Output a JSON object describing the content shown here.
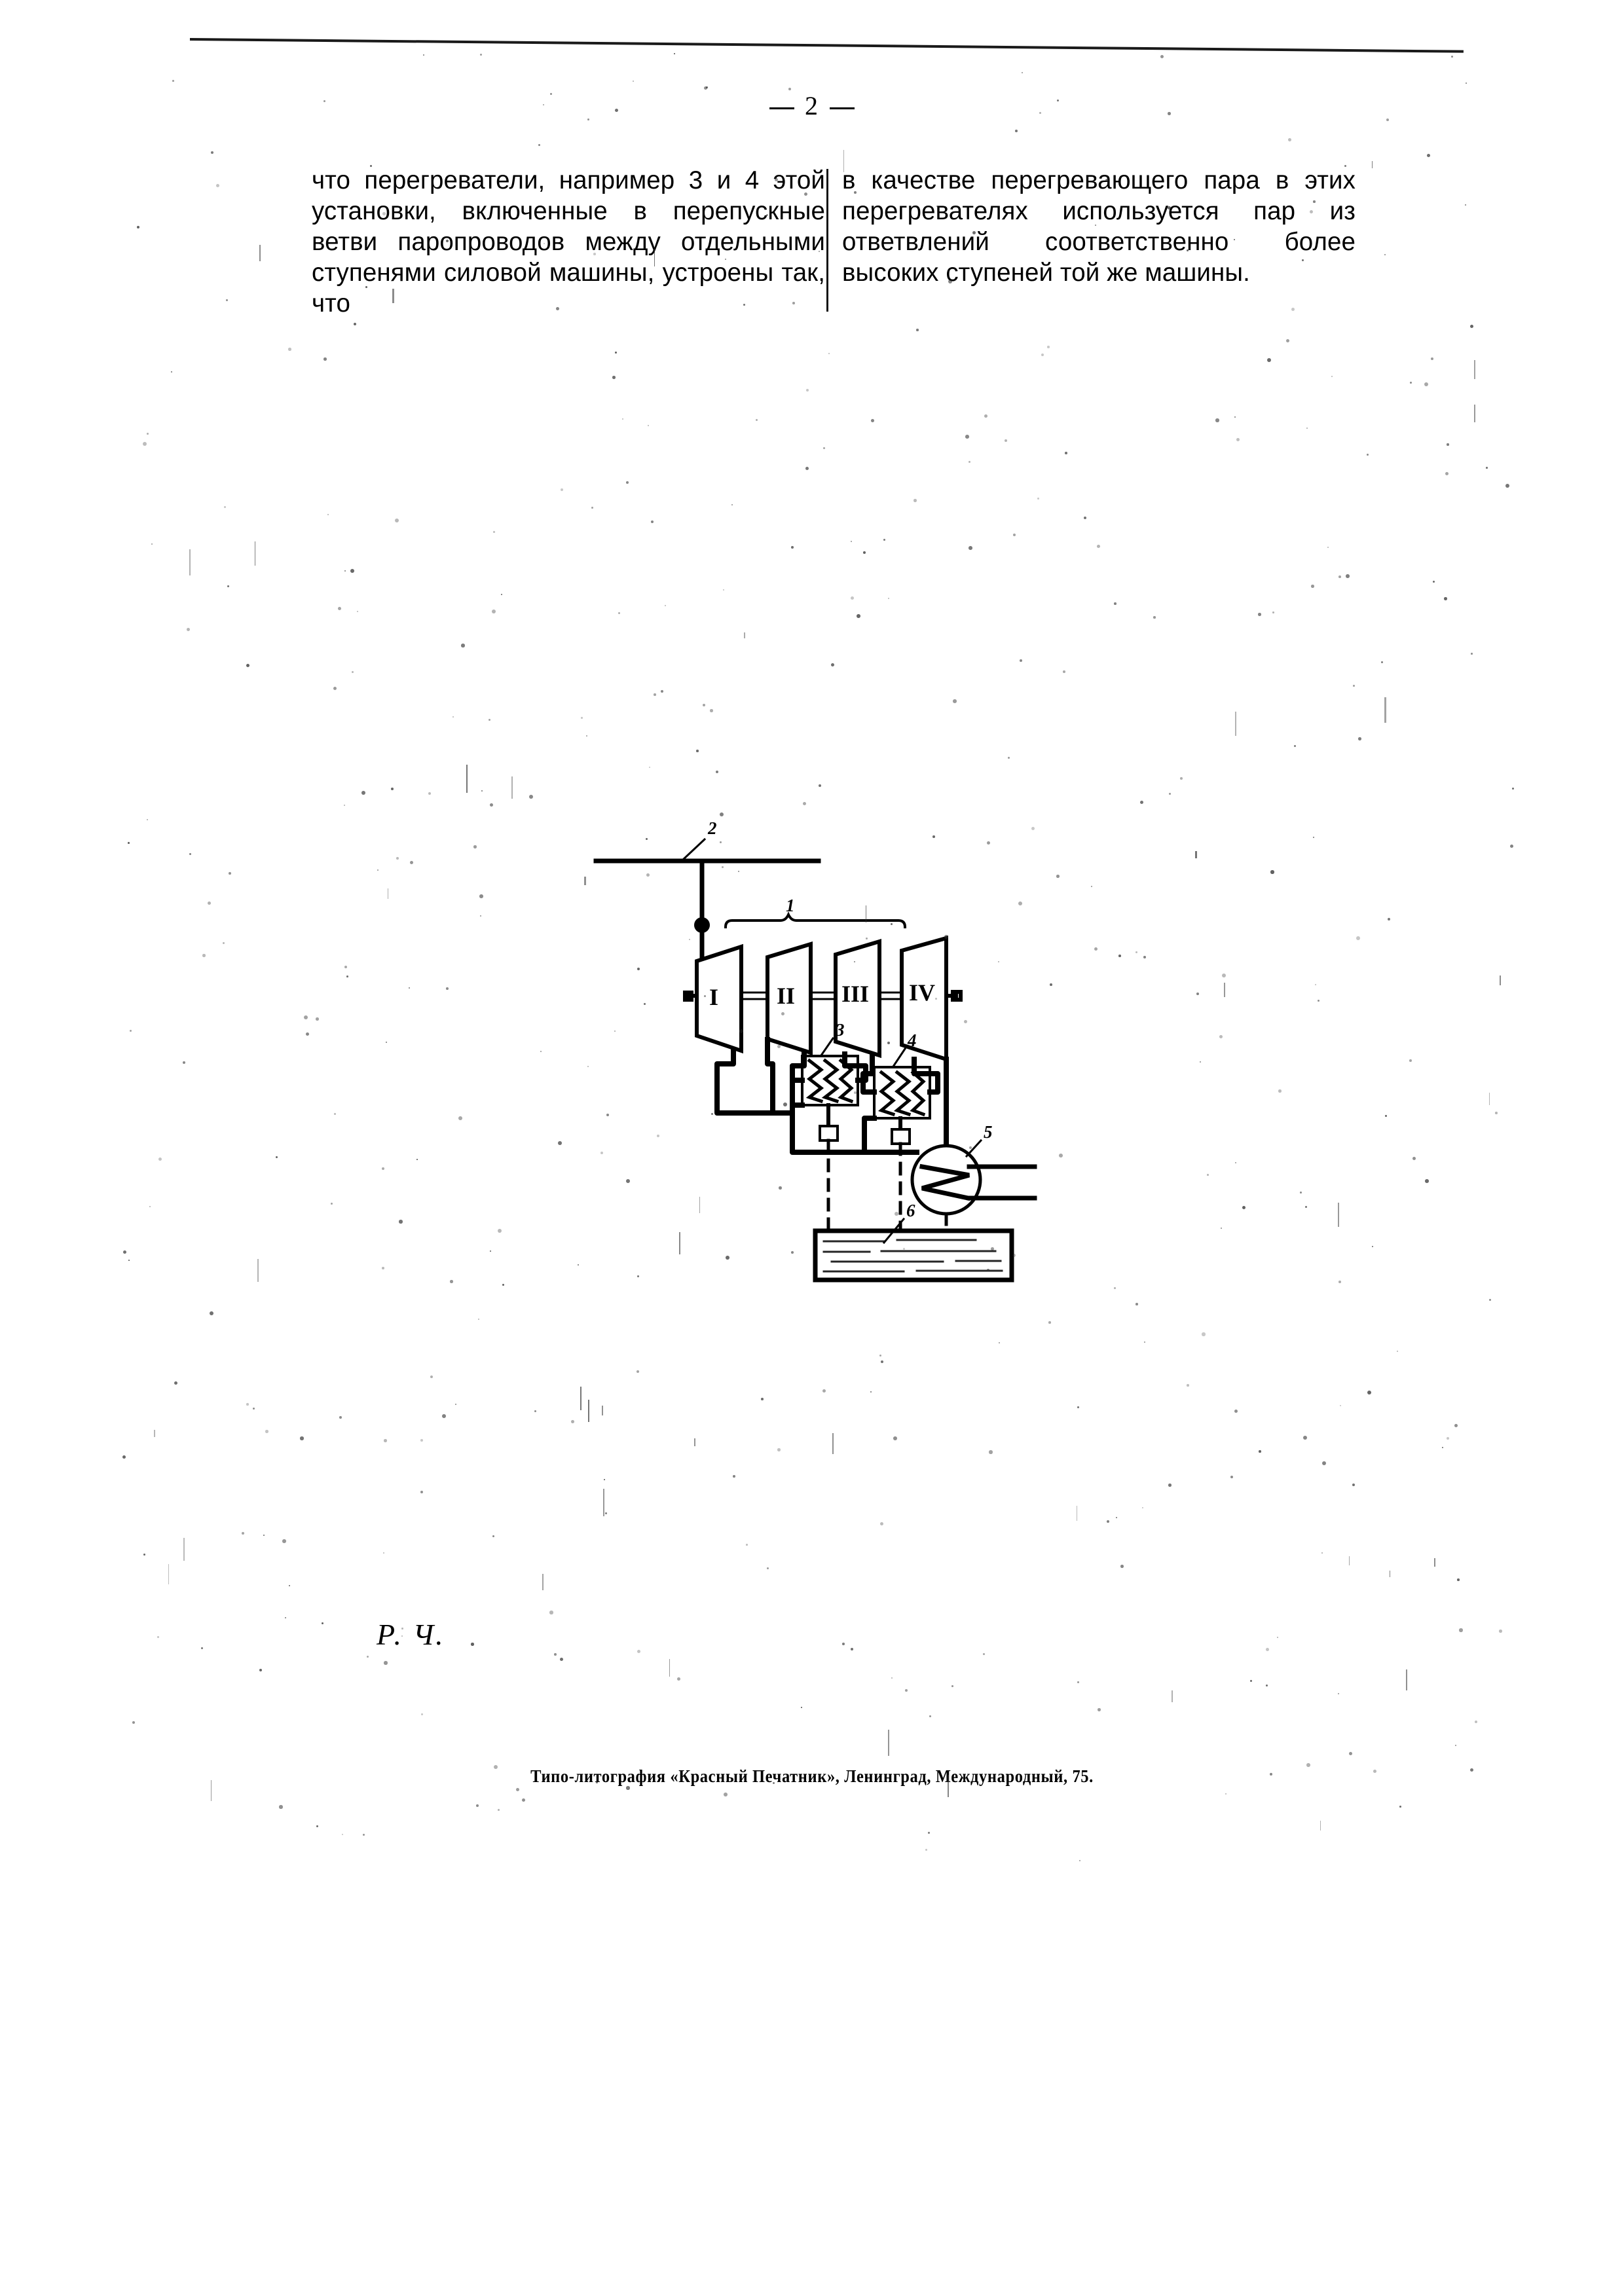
{
  "page": {
    "number_display": "2",
    "folio_left_dash": "—",
    "folio_right_dash": "—"
  },
  "body": {
    "left_column": "что перегреватели, например 3 и 4 этой установки, включенные в перепускные ветви паропроводов между отдельными ступенями силовой машины, устроены так, что",
    "right_column": "в качестве перегревающего пара в этих перегревателях используется пар из ответвлений соответственно более высоких ступеней той же машины."
  },
  "figure": {
    "caption_labels": {
      "turbine_group": "1",
      "steam_main": "2",
      "superheater_first": "3",
      "superheater_second": "4",
      "condenser": "5",
      "feed_tank": "6"
    },
    "turbine_stages": [
      {
        "numeral": "I"
      },
      {
        "numeral": "II"
      },
      {
        "numeral": "III"
      },
      {
        "numeral": "IV"
      }
    ]
  },
  "signature": "Р. Ч.",
  "imprint": "Типо-литография «Красный Печатник», Ленинград, Международный, 75."
}
